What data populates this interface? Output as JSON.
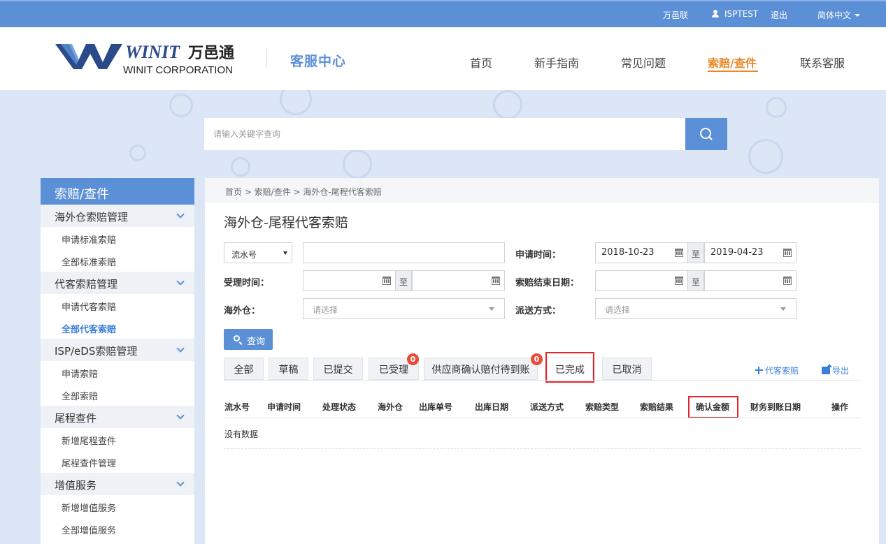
{
  "topbar": {
    "brand_link": "万邑联",
    "username": "ISPTEST",
    "logout": "退出",
    "language": "简体中文"
  },
  "header": {
    "logo_main": "WINIT",
    "logo_cn": "万邑通",
    "logo_sub": "WINIT CORPORATION",
    "service_title": "客服中心",
    "nav": [
      "首页",
      "新手指南",
      "常见问题",
      "索赔/查件",
      "联系客服"
    ],
    "active_nav": "索赔/查件"
  },
  "search": {
    "placeholder": "请输入关键字查询"
  },
  "sidebar": {
    "title": "索赔/查件",
    "groups": [
      {
        "label": "海外仓索赔管理",
        "items": [
          "申请标准索赔",
          "全部标准索赔"
        ]
      },
      {
        "label": "代客索赔管理",
        "items": [
          "申请代客索赔",
          "全部代客索赔"
        ]
      },
      {
        "label": "ISP/eDS索赔管理",
        "items": [
          "申请索赔",
          "全部索赔"
        ]
      },
      {
        "label": "尾程查件",
        "items": [
          "新增尾程查件",
          "尾程查件管理"
        ]
      },
      {
        "label": "增值服务",
        "items": [
          "新增增值服务",
          "全部增值服务"
        ]
      }
    ],
    "active_item": "全部代客索赔"
  },
  "main": {
    "breadcrumb": "首页 > 索赔/查件 > 海外仓-尾程代客索赔",
    "title": "海外仓-尾程代客索赔",
    "filters": {
      "type_select": "流水号",
      "type_value": "",
      "apply_time_label": "申请时间：",
      "apply_from": "2018-10-23",
      "apply_to": "2019-04-23",
      "to_text": "至",
      "accept_time_label": "受理时间：",
      "accept_from": "",
      "accept_to": "",
      "claim_end_label": "索赔结束日期：",
      "claim_end_from": "",
      "claim_end_to": "",
      "warehouse_label": "海外仓：",
      "warehouse_placeholder": "请选择",
      "delivery_label": "派送方式：",
      "delivery_placeholder": "请选择"
    },
    "query_button": "查询",
    "tabs": [
      {
        "label": "全部"
      },
      {
        "label": "草稿"
      },
      {
        "label": "已提交"
      },
      {
        "label": "已受理",
        "badge": "0"
      },
      {
        "label": "供应商确认赔付待到账",
        "badge": "0"
      },
      {
        "label": "已完成"
      },
      {
        "label": "已取消"
      }
    ],
    "active_tab": "已完成",
    "add_claim": "代客索赔",
    "export": "导出",
    "columns": [
      "流水号",
      "申请时间",
      "处理状态",
      "海外仓",
      "出库单号",
      "出库日期",
      "派送方式",
      "索赔类型",
      "索赔结果",
      "确认金额",
      "财务到账日期",
      "操作"
    ],
    "empty": "没有数据"
  },
  "colors": {
    "primary": "#5b8fd6",
    "accent": "#e8892b",
    "highlight": "#e0262b",
    "badge": "#e84b3a"
  }
}
